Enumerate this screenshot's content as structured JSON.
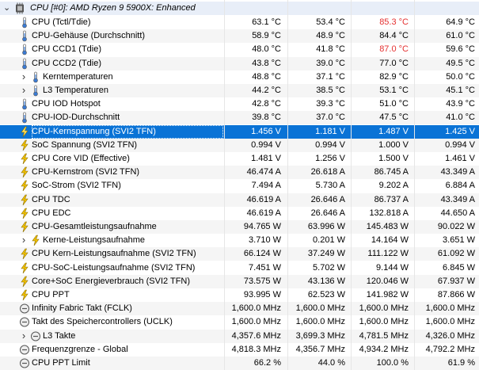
{
  "group": {
    "label": "CPU [#0]: AMD Ryzen 9 5900X: Enhanced",
    "icon": "cpu-chip-icon"
  },
  "colors": {
    "selection": "#0a73d6",
    "alarm": "#e53030",
    "voltage_icon": "#f2c200",
    "temp_icon": "#3a7bd5"
  },
  "rows": [
    {
      "label": "CPU (Tctl/Tdie)",
      "icon": "thermometer-icon",
      "indent": 0,
      "expand": false,
      "values": [
        "63.1 °C",
        "53.4 °C",
        "85.3 °C",
        "64.9 °C"
      ],
      "red": [
        2
      ]
    },
    {
      "label": "CPU-Gehäuse (Durchschnitt)",
      "icon": "thermometer-icon",
      "indent": 0,
      "expand": false,
      "values": [
        "58.9 °C",
        "48.9 °C",
        "84.4 °C",
        "61.0 °C"
      ],
      "red": []
    },
    {
      "label": "CPU CCD1 (Tdie)",
      "icon": "thermometer-icon",
      "indent": 0,
      "expand": false,
      "values": [
        "48.0 °C",
        "41.8 °C",
        "87.0 °C",
        "59.6 °C"
      ],
      "red": [
        2
      ]
    },
    {
      "label": "CPU CCD2 (Tdie)",
      "icon": "thermometer-icon",
      "indent": 0,
      "expand": false,
      "values": [
        "43.8 °C",
        "39.0 °C",
        "77.0 °C",
        "49.5 °C"
      ],
      "red": []
    },
    {
      "label": "Kerntemperaturen",
      "icon": "thermometer-icon",
      "indent": 1,
      "expand": true,
      "values": [
        "48.8 °C",
        "37.1 °C",
        "82.9 °C",
        "50.0 °C"
      ],
      "red": []
    },
    {
      "label": "L3 Temperaturen",
      "icon": "thermometer-icon",
      "indent": 1,
      "expand": true,
      "values": [
        "44.2 °C",
        "38.5 °C",
        "53.1 °C",
        "45.1 °C"
      ],
      "red": []
    },
    {
      "label": "CPU IOD Hotspot",
      "icon": "thermometer-icon",
      "indent": 0,
      "expand": false,
      "values": [
        "42.8 °C",
        "39.3 °C",
        "51.0 °C",
        "43.9 °C"
      ],
      "red": []
    },
    {
      "label": "CPU-IOD-Durchschnitt",
      "icon": "thermometer-icon",
      "indent": 0,
      "expand": false,
      "values": [
        "39.8 °C",
        "37.0 °C",
        "47.5 °C",
        "41.0 °C"
      ],
      "red": []
    },
    {
      "label": "CPU-Kernspannung (SVI2 TFN)",
      "icon": "lightning-icon",
      "indent": 0,
      "expand": false,
      "values": [
        "1.456 V",
        "1.181 V",
        "1.487 V",
        "1.425 V"
      ],
      "red": [],
      "selected": true
    },
    {
      "label": "SoC Spannung (SVI2 TFN)",
      "icon": "lightning-icon",
      "indent": 0,
      "expand": false,
      "values": [
        "0.994 V",
        "0.994 V",
        "1.000 V",
        "0.994 V"
      ],
      "red": []
    },
    {
      "label": "CPU Core VID (Effective)",
      "icon": "lightning-icon",
      "indent": 0,
      "expand": false,
      "values": [
        "1.481 V",
        "1.256 V",
        "1.500 V",
        "1.461 V"
      ],
      "red": []
    },
    {
      "label": "CPU-Kernstrom (SVI2 TFN)",
      "icon": "lightning-icon",
      "indent": 0,
      "expand": false,
      "values": [
        "46.474 A",
        "26.618 A",
        "86.745 A",
        "43.349 A"
      ],
      "red": []
    },
    {
      "label": "SoC-Strom (SVI2 TFN)",
      "icon": "lightning-icon",
      "indent": 0,
      "expand": false,
      "values": [
        "7.494 A",
        "5.730 A",
        "9.202 A",
        "6.884 A"
      ],
      "red": []
    },
    {
      "label": "CPU TDC",
      "icon": "lightning-icon",
      "indent": 0,
      "expand": false,
      "values": [
        "46.619 A",
        "26.646 A",
        "86.737 A",
        "43.349 A"
      ],
      "red": []
    },
    {
      "label": "CPU EDC",
      "icon": "lightning-icon",
      "indent": 0,
      "expand": false,
      "values": [
        "46.619 A",
        "26.646 A",
        "132.818 A",
        "44.650 A"
      ],
      "red": []
    },
    {
      "label": "CPU-Gesamtleistungsaufnahme",
      "icon": "lightning-icon",
      "indent": 0,
      "expand": false,
      "values": [
        "94.765 W",
        "63.996 W",
        "145.483 W",
        "90.022 W"
      ],
      "red": []
    },
    {
      "label": "Kerne-Leistungsaufnahme",
      "icon": "lightning-icon",
      "indent": 1,
      "expand": true,
      "values": [
        "3.710 W",
        "0.201 W",
        "14.164 W",
        "3.651 W"
      ],
      "red": []
    },
    {
      "label": "CPU Kern-Leistungsaufnahme (SVI2 TFN)",
      "icon": "lightning-icon",
      "indent": 0,
      "expand": false,
      "values": [
        "66.124 W",
        "37.249 W",
        "111.122 W",
        "61.092 W"
      ],
      "red": []
    },
    {
      "label": "CPU-SoC-Leistungsaufnahme (SVI2 TFN)",
      "icon": "lightning-icon",
      "indent": 0,
      "expand": false,
      "values": [
        "7.451 W",
        "5.702 W",
        "9.144 W",
        "6.845 W"
      ],
      "red": []
    },
    {
      "label": "Core+SoC Energieverbrauch (SVI2 TFN)",
      "icon": "lightning-icon",
      "indent": 0,
      "expand": false,
      "values": [
        "73.575 W",
        "43.136 W",
        "120.046 W",
        "67.937 W"
      ],
      "red": []
    },
    {
      "label": "CPU PPT",
      "icon": "lightning-icon",
      "indent": 0,
      "expand": false,
      "values": [
        "93.995 W",
        "62.523 W",
        "141.982 W",
        "87.866 W"
      ],
      "red": []
    },
    {
      "label": "Infinity Fabric Takt (FCLK)",
      "icon": "clock-icon",
      "indent": 0,
      "expand": false,
      "values": [
        "1,600.0 MHz",
        "1,600.0 MHz",
        "1,600.0 MHz",
        "1,600.0 MHz"
      ],
      "red": []
    },
    {
      "label": "Takt des Speichercontrollers (UCLK)",
      "icon": "clock-icon",
      "indent": 0,
      "expand": false,
      "values": [
        "1,600.0 MHz",
        "1,600.0 MHz",
        "1,600.0 MHz",
        "1,600.0 MHz"
      ],
      "red": []
    },
    {
      "label": "L3 Takte",
      "icon": "clock-icon",
      "indent": 1,
      "expand": true,
      "values": [
        "4,357.6 MHz",
        "3,699.3 MHz",
        "4,781.5 MHz",
        "4,326.0 MHz"
      ],
      "red": []
    },
    {
      "label": "Frequenzgrenze - Global",
      "icon": "clock-icon",
      "indent": 0,
      "expand": false,
      "values": [
        "4,818.3 MHz",
        "4,356.7 MHz",
        "4,934.2 MHz",
        "4,792.2 MHz"
      ],
      "red": []
    },
    {
      "label": "CPU PPT Limit",
      "icon": "clock-icon",
      "indent": 0,
      "expand": false,
      "values": [
        "66.2 %",
        "44.0 %",
        "100.0 %",
        "61.9 %"
      ],
      "red": []
    }
  ]
}
